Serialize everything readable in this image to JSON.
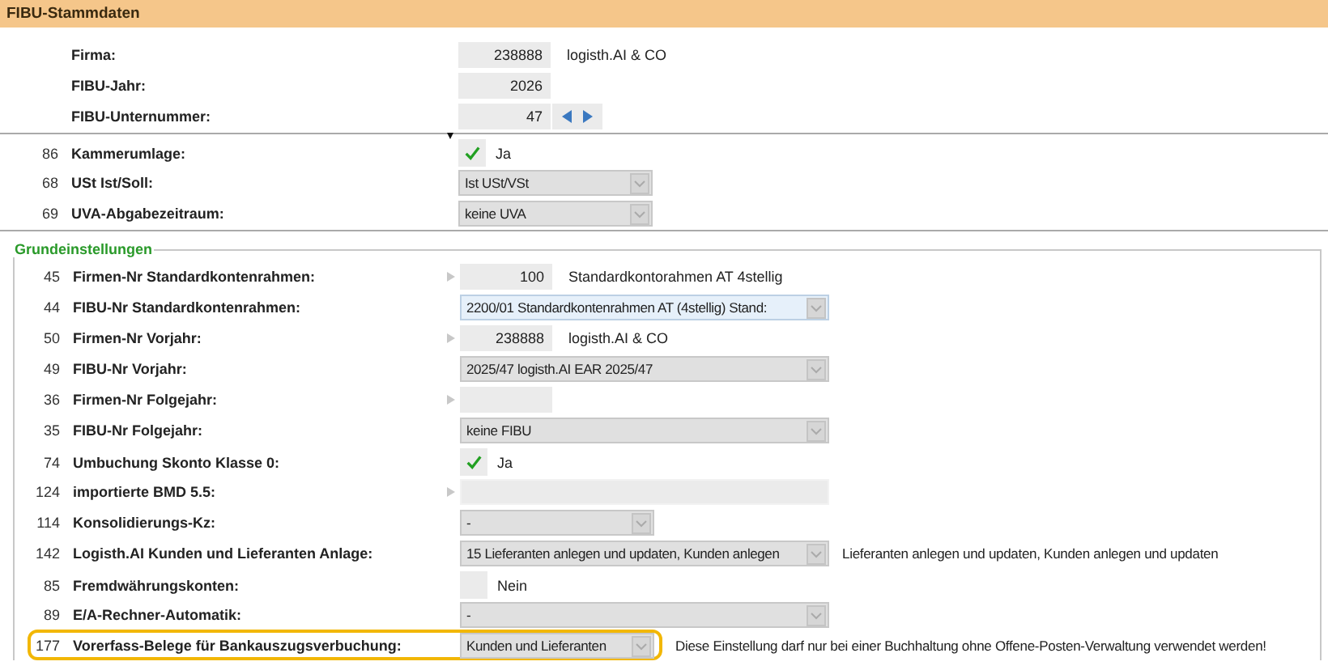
{
  "header": {
    "title": "FIBU-Stammdaten"
  },
  "company": [
    {
      "label": "Firma:",
      "value": "238888",
      "aside": "logisth.AI & CO",
      "spinner": false
    },
    {
      "label": "FIBU-Jahr:",
      "value": "2026",
      "spinner": false
    },
    {
      "label": "FIBU-Unternummer:",
      "value": "47",
      "spinner": true
    }
  ],
  "settings": [
    {
      "number": "86",
      "label": "Kammerumlage:",
      "kind": "checkbox",
      "checked": true,
      "text": "Ja",
      "note_mark": true
    },
    {
      "number": "68",
      "label": "USt Ist/Soll:",
      "kind": "select",
      "value": "Ist USt/VSt",
      "compact": true,
      "focused": false
    },
    {
      "number": "69",
      "label": "UVA-Abgabezeitraum:",
      "kind": "select",
      "value": "keine UVA",
      "compact": true,
      "focused": false
    }
  ],
  "group": {
    "legend": "Grundeinstellungen",
    "rows": [
      {
        "number": "45",
        "label": "Firmen-Nr Standardkontenrahmen:",
        "kind": "number",
        "value": "100",
        "aside": "Standardkontorahmen AT 4stellig",
        "linked": true,
        "highlighted": false
      },
      {
        "number": "44",
        "label": "FIBU-Nr Standardkontenrahmen:",
        "kind": "select",
        "value": "2200/01 Standardkontenrahmen AT (4stellig) Stand:",
        "compact": false,
        "focused": true,
        "highlighted": false
      },
      {
        "number": "50",
        "label": "Firmen-Nr Vorjahr:",
        "kind": "number",
        "value": "238888",
        "aside": "logisth.AI & CO",
        "linked": true,
        "highlighted": false
      },
      {
        "number": "49",
        "label": "FIBU-Nr Vorjahr:",
        "kind": "select",
        "value": "2025/47 logisth.AI EAR 2025/47",
        "compact": false,
        "focused": false,
        "highlighted": false
      },
      {
        "number": "36",
        "label": "Firmen-Nr Folgejahr:",
        "kind": "number",
        "linked": true,
        "highlighted": false
      },
      {
        "number": "35",
        "label": "FIBU-Nr Folgejahr:",
        "kind": "select",
        "value": "keine FIBU",
        "compact": false,
        "focused": false,
        "highlighted": false
      },
      {
        "number": "74",
        "label": "Umbuchung Skonto Klasse 0:",
        "kind": "checkbox",
        "checked": true,
        "text": "Ja",
        "note_mark": false,
        "highlighted": false
      },
      {
        "number": "124",
        "label": "importierte BMD 5.5:",
        "kind": "text",
        "linked": true,
        "highlighted": false
      },
      {
        "number": "114",
        "label": "Konsolidierungs-Kz:",
        "kind": "select",
        "value": "-",
        "compact": true,
        "focused": false,
        "highlighted": false
      },
      {
        "number": "142",
        "label": "Logisth.AI Kunden und Lieferanten Anlage:",
        "kind": "select",
        "value": "15 Lieferanten anlegen und updaten, Kunden anlegen",
        "aside": "Lieferanten anlegen und updaten, Kunden anlegen und updaten",
        "compact": false,
        "focused": false,
        "highlighted": false
      },
      {
        "number": "85",
        "label": "Fremdwährungskonten:",
        "kind": "checkbox",
        "checked": false,
        "text": "Nein",
        "note_mark": false,
        "highlighted": false
      },
      {
        "number": "89",
        "label": "E/A-Rechner-Automatik:",
        "kind": "select",
        "value": "-",
        "compact": false,
        "focused": false,
        "highlighted": false
      },
      {
        "number": "177",
        "label": "Vorerfass-Belege für Bankauszugsverbuchung:",
        "kind": "select",
        "value": "Kunden und Lieferanten",
        "aside": "Diese Einstellung darf nur bei einer Buchhaltung ohne Offene-Posten-Verwaltung verwendet werden!",
        "compact": true,
        "focused": false,
        "highlighted": true
      }
    ]
  }
}
